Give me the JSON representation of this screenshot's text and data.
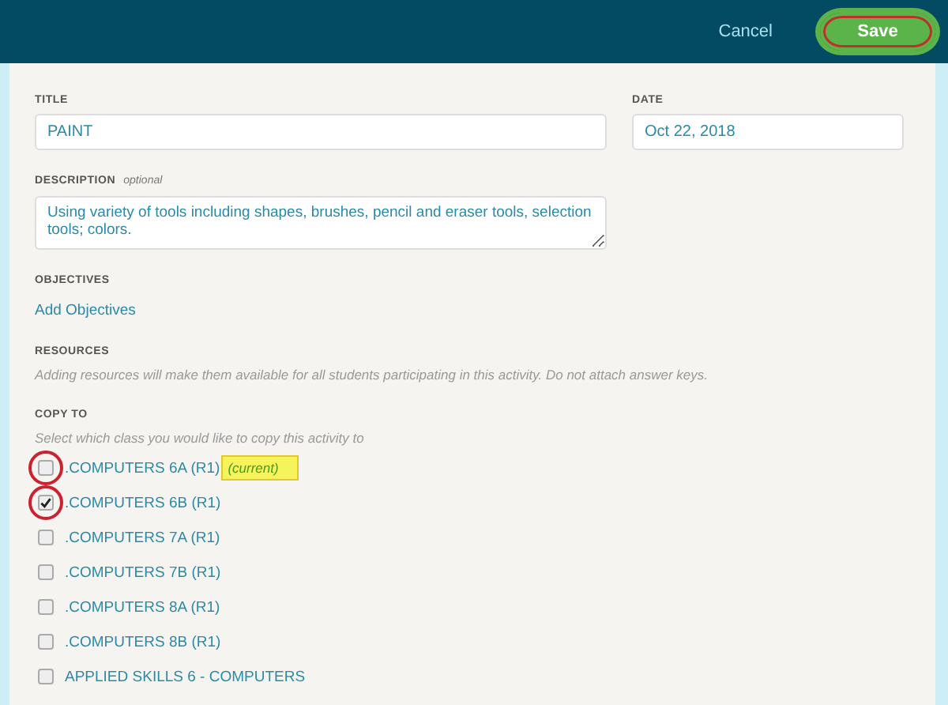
{
  "header": {
    "cancel": "Cancel",
    "save": {
      "label": "Save",
      "circled": true
    }
  },
  "title": {
    "label": "TITLE",
    "value": "PAINT"
  },
  "date": {
    "label": "DATE",
    "value": "Oct 22, 2018"
  },
  "description": {
    "label": "DESCRIPTION",
    "hint": "optional",
    "value": "Using variety of tools including shapes, brushes, pencil and eraser tools, selection tools; colors."
  },
  "objectives": {
    "label": "OBJECTIVES",
    "link": "Add Objectives"
  },
  "resources": {
    "label": "RESOURCES",
    "hint": "Adding resources will make them available for all students participating in this activity. Do not attach answer keys."
  },
  "copy_to": {
    "label": "COPY TO",
    "hint": "Select which class you would like to copy this activity to",
    "classes": [
      {
        "name": ".COMPUTERS 6A (R1)",
        "checked": false,
        "circled": true,
        "tag": "(current)"
      },
      {
        "name": ".COMPUTERS 6B (R1)",
        "checked": true,
        "circled": true
      },
      {
        "name": ".COMPUTERS 7A (R1)",
        "checked": false,
        "circled": false
      },
      {
        "name": ".COMPUTERS 7B (R1)",
        "checked": false,
        "circled": false
      },
      {
        "name": ".COMPUTERS 8A (R1)",
        "checked": false,
        "circled": false
      },
      {
        "name": ".COMPUTERS 8B (R1)",
        "checked": false,
        "circled": false
      },
      {
        "name": "APPLIED SKILLS 6 - COMPUTERS",
        "checked": false,
        "circled": false
      }
    ]
  }
}
